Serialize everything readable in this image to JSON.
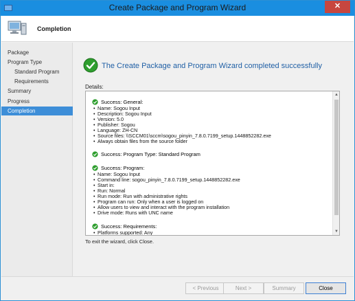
{
  "window": {
    "title": "Create Package and Program Wizard",
    "close_glyph": "✕"
  },
  "header": {
    "title": "Completion",
    "icon": "computer-icon"
  },
  "sidebar": {
    "items": [
      {
        "label": "Package",
        "indent": 0,
        "active": false
      },
      {
        "label": "Program Type",
        "indent": 0,
        "active": false
      },
      {
        "label": "Standard Program",
        "indent": 1,
        "active": false
      },
      {
        "label": "Requirements",
        "indent": 1,
        "active": false
      },
      {
        "label": "Summary",
        "indent": 0,
        "active": false
      },
      {
        "label": "Progress",
        "indent": 0,
        "active": false
      },
      {
        "label": "Completion",
        "indent": 0,
        "active": true
      }
    ]
  },
  "main": {
    "success_heading": "The Create Package and Program Wizard completed successfully",
    "details_label": "Details:",
    "sections": [
      {
        "title": "Success: General:",
        "items": [
          "Name: Sogou Input",
          "Description: Sogou Input",
          "Version: 5.0",
          "Publisher: Sogou",
          "Language: ZH-CN",
          "Source files: \\\\SCCM01\\sccm\\sogou_pinyin_7.8.0.7199_setup.1448852282.exe",
          "Always obtain files from the source folder"
        ]
      },
      {
        "title": "Success: Program Type: Standard Program",
        "items": []
      },
      {
        "title": "Success: Program:",
        "items": [
          "Name: Sogou Input",
          "Command line: sogou_pinyin_7.8.0.7199_setup.1448852282.exe",
          "Start in:",
          "Run: Normal",
          "Run mode: Run with administrative rights",
          "Program can run: Only when a user is logged on",
          "Allow users to view and interact with the program installation",
          "Drive mode: Runs with UNC name"
        ]
      },
      {
        "title": "Success: Requirements:",
        "items": [
          "Platforms supported: Any"
        ]
      }
    ],
    "exit_text": "To exit the wizard, click Close."
  },
  "footer": {
    "previous_label": "< Previous",
    "next_label": "Next >",
    "summary_label": "Summary",
    "close_label": "Close"
  },
  "colors": {
    "titlebar": "#1a8ee0",
    "heading": "#1f5fa5",
    "success_green": "#2e9e2e",
    "active_nav": "#3d8ed8"
  }
}
